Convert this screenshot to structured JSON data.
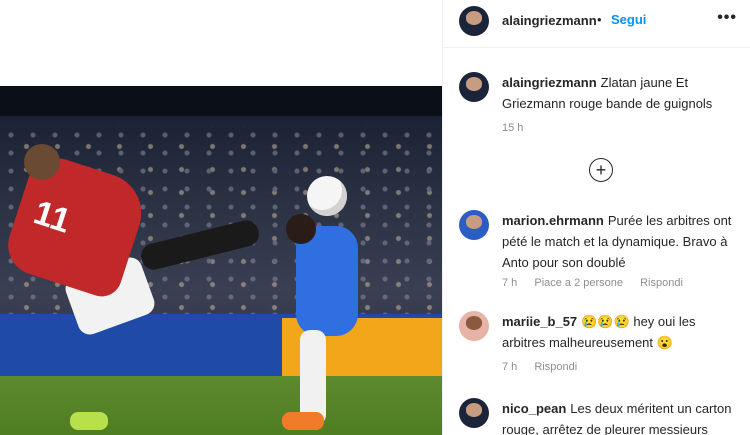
{
  "post": {
    "author": "alaingriezmann",
    "follow_label": "Segui",
    "separator": "•",
    "more_icon": "more-horizontal-icon",
    "caption": {
      "username": "alaingriezmann",
      "text": "Zlatan jaune Et Griezmann rouge bande de guignols",
      "time": "15 h"
    },
    "load_more_icon": "plus-circle-icon"
  },
  "video": {
    "player_number": "11"
  },
  "comments": [
    {
      "username": "marion.ehrmann",
      "text": "Purée les arbitres ont pété le match et la dynamique. Bravo à Anto pour son doublé",
      "time": "7 h",
      "likes": "Piace a 2 persone",
      "reply": "Rispondi"
    },
    {
      "username": "mariie_b_57",
      "text": "😢😢😢 hey oui les arbitres malheureusement 😮",
      "time": "7 h",
      "reply": "Rispondi"
    },
    {
      "username": "nico_pean",
      "text": "Les deux méritent un carton rouge, arrêtez de pleurer messieurs"
    }
  ]
}
